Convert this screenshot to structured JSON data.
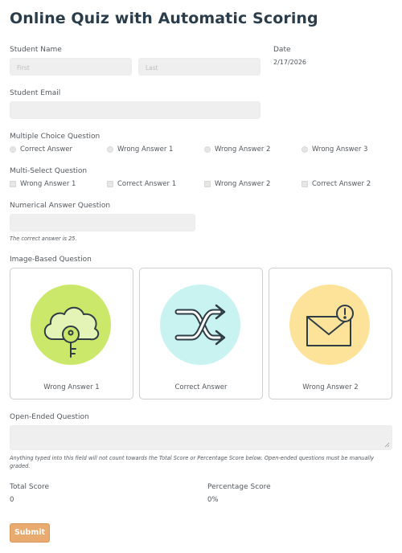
{
  "title": "Online Quiz with Automatic Scoring",
  "student_name": {
    "label": "Student Name",
    "first_placeholder": "First",
    "last_placeholder": "Last"
  },
  "date": {
    "label": "Date",
    "value": "2/17/2026"
  },
  "student_email": {
    "label": "Student Email",
    "value": ""
  },
  "multiple_choice": {
    "label": "Multiple Choice Question",
    "options": [
      "Correct Answer",
      "Wrong Answer 1",
      "Wrong Answer 2",
      "Wrong Answer 3"
    ]
  },
  "multi_select": {
    "label": "Multi-Select Question",
    "options": [
      "Wrong Answer 1",
      "Correct Answer 1",
      "Wrong Answer 2",
      "Correct Answer 2"
    ]
  },
  "numerical": {
    "label": "Numerical Answer Question",
    "value": "",
    "hint": "The correct answer is 25."
  },
  "image_based": {
    "label": "Image-Based Question",
    "cards": [
      {
        "caption": "Wrong Answer 1",
        "icon": "cloud-key-icon",
        "color": "#cbe86b"
      },
      {
        "caption": "Correct Answer",
        "icon": "shuffle-arrows-icon",
        "color": "#c9f3f1"
      },
      {
        "caption": "Wrong Answer 2",
        "icon": "envelope-alert-icon",
        "color": "#fde29a"
      }
    ]
  },
  "open_ended": {
    "label": "Open-Ended Question",
    "value": "",
    "note": "Anything typed into this field will not count towards the Total Score or Percentage Score below. Open-ended questions must be manually graded."
  },
  "scores": {
    "total_label": "Total Score",
    "total_value": "0",
    "percentage_label": "Percentage Score",
    "percentage_value": "0%"
  },
  "submit_label": "Submit",
  "colors": {
    "title": "#2b3d4a",
    "submit": "#e8aa6e",
    "field": "#efefef"
  }
}
